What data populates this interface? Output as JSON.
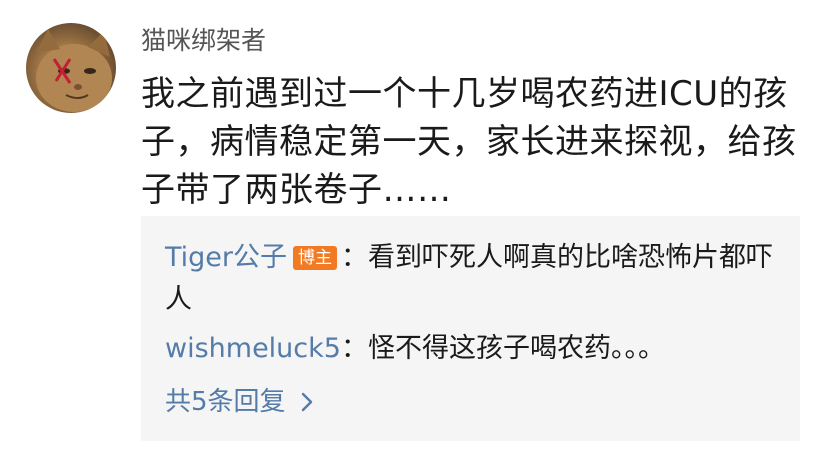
{
  "comment": {
    "username": "猫咪绑架者",
    "text": "我之前遇到过一个十几岁喝农药进ICU的孩子，病情稳定第一天，家长进来探视，给孩子带了两张卷子……"
  },
  "replies": [
    {
      "author": "Tiger公子",
      "badge": "博主",
      "separator": "：",
      "text": "看到吓死人啊真的比啥恐怖片都吓人"
    },
    {
      "author": "wishmeluck5",
      "separator": "：",
      "text": "怪不得这孩子喝农药。。。"
    }
  ],
  "more_replies": {
    "label": "共5条回复",
    "icon": "chevron-right-icon"
  },
  "colors": {
    "link": "#557ba8",
    "badge": "#f27a22",
    "reply_background": "#f5f5f5"
  }
}
